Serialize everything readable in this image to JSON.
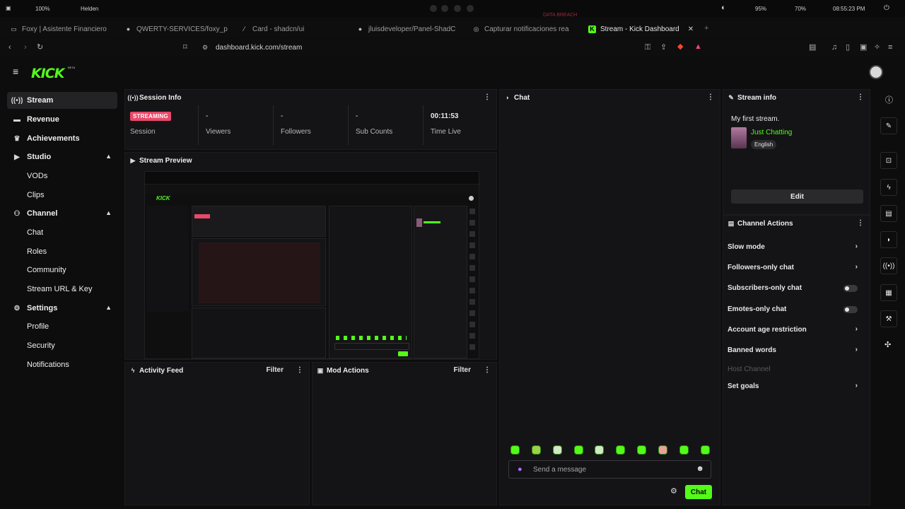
{
  "system": {
    "zoom": "100%",
    "profile": "Helden",
    "status_a": "95%",
    "status_b": "70%",
    "clock": "08:55:23 PM",
    "overlay_text": "DATA BREACH"
  },
  "browser": {
    "tabs": [
      {
        "label": "Foxy | Asistente Financiero",
        "icon": "page-icon"
      },
      {
        "label": "QWERTY-SERVICES/foxy_p",
        "icon": "github-icon"
      },
      {
        "label": "Card - shadcn/ui",
        "icon": "slash-icon"
      },
      {
        "label": "jluisdeveloper/Panel-ShadC",
        "icon": "github-icon"
      },
      {
        "label": "Capturar notificaciones rea",
        "icon": "globe-icon"
      },
      {
        "label": "Stream - Kick Dashboard",
        "icon": "kick-icon",
        "active": true
      }
    ],
    "url": "dashboard.kick.com/stream"
  },
  "app": {
    "logo": "KICK",
    "logo_badge": "BETA",
    "accent": "#53fc18"
  },
  "sidebar": {
    "items": [
      {
        "label": "Stream",
        "icon": "broadcast-icon"
      },
      {
        "label": "Revenue",
        "icon": "wallet-icon"
      },
      {
        "label": "Achievements",
        "icon": "trophy-icon"
      },
      {
        "label": "Studio",
        "icon": "video-icon"
      },
      {
        "label": "VODs"
      },
      {
        "label": "Clips"
      },
      {
        "label": "Channel",
        "icon": "users-icon"
      },
      {
        "label": "Chat"
      },
      {
        "label": "Roles"
      },
      {
        "label": "Community"
      },
      {
        "label": "Stream URL & Key"
      },
      {
        "label": "Settings",
        "icon": "gear-icon"
      },
      {
        "label": "Profile"
      },
      {
        "label": "Security"
      },
      {
        "label": "Notifications"
      }
    ]
  },
  "session_info": {
    "title": "Session Info",
    "status_badge": "STREAMING",
    "stats": [
      {
        "value": "",
        "label": "Session"
      },
      {
        "value": "-",
        "label": "Viewers"
      },
      {
        "value": "-",
        "label": "Followers"
      },
      {
        "value": "-",
        "label": "Sub Counts"
      },
      {
        "value": "00:11:53",
        "label": "Time Live"
      }
    ]
  },
  "stream_preview": {
    "title": "Stream Preview"
  },
  "activity_feed": {
    "title": "Activity Feed",
    "filter": "Filter"
  },
  "mod_actions": {
    "title": "Mod Actions",
    "filter": "Filter"
  },
  "chat": {
    "title": "Chat",
    "placeholder": "Send a message",
    "send_label": "Chat"
  },
  "stream_info": {
    "title": "Stream info",
    "stream_title": "My first stream.",
    "category": "Just Chatting",
    "language": "English",
    "edit_label": "Edit"
  },
  "channel_actions": {
    "title": "Channel Actions",
    "items": [
      {
        "label": "Slow mode",
        "control": "arrow"
      },
      {
        "label": "Followers-only chat",
        "control": "arrow"
      },
      {
        "label": "Subscribers-only chat",
        "control": "toggle",
        "on": false
      },
      {
        "label": "Emotes-only chat",
        "control": "toggle",
        "on": false
      },
      {
        "label": "Account age restriction",
        "control": "arrow"
      },
      {
        "label": "Banned words",
        "control": "arrow"
      },
      {
        "label": "Host Channel",
        "control": "none",
        "disabled": true
      },
      {
        "label": "Set goals",
        "control": "arrow"
      }
    ]
  }
}
